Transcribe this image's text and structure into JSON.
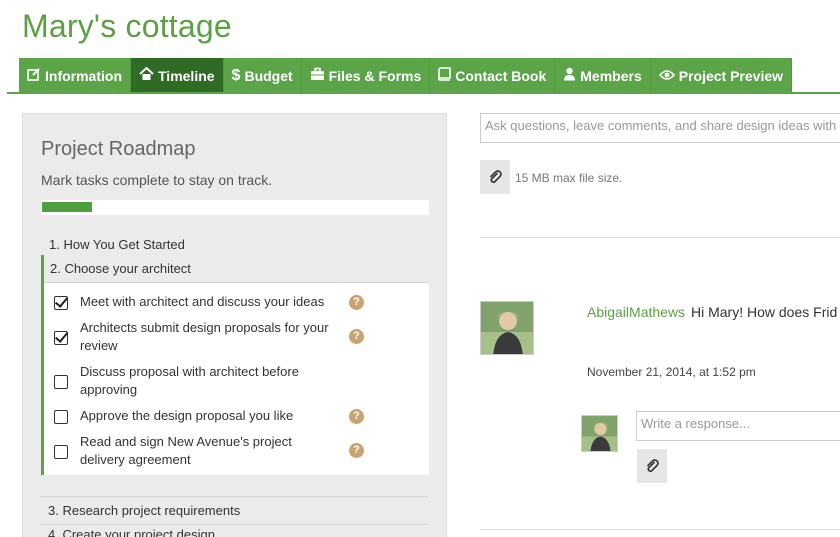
{
  "project": {
    "title": "Mary's cottage"
  },
  "tabs": [
    {
      "label": "Information",
      "icon": "edit-icon"
    },
    {
      "label": "Timeline",
      "icon": "home-icon",
      "active": true
    },
    {
      "label": "Budget",
      "icon": "dollar-icon"
    },
    {
      "label": "Files & Forms",
      "icon": "briefcase-icon"
    },
    {
      "label": "Contact Book",
      "icon": "book-icon"
    },
    {
      "label": "Members",
      "icon": "user-icon"
    },
    {
      "label": "Project Preview",
      "icon": "eye-icon"
    }
  ],
  "roadmap": {
    "title": "Project Roadmap",
    "subtitle": "Mark tasks complete to stay on track.",
    "progress": 0.13,
    "steps": [
      {
        "label": "1. How You Get Started"
      },
      {
        "label": "2. Choose your architect",
        "tasks": [
          {
            "text": "Meet with architect and discuss your ideas",
            "checked": true,
            "help": true
          },
          {
            "text": "Architects submit design proposals for your review",
            "checked": true,
            "help": true
          },
          {
            "text": "Discuss proposal with architect before approving",
            "checked": false,
            "help": false
          },
          {
            "text": "Approve the design proposal you like",
            "checked": false,
            "help": true
          },
          {
            "text": "Read and sign New Avenue's project delivery agreement",
            "checked": false,
            "help": true
          }
        ]
      },
      {
        "label": "3. Research project requirements"
      },
      {
        "label": "4. Create your project design"
      }
    ],
    "help_glyph": "?"
  },
  "feed": {
    "comment_placeholder": "Ask questions, leave comments, and share design ideas with",
    "max_file_note": "15 MB max file size.",
    "post": {
      "author": "AbigailMathews",
      "text": "Hi Mary! How does Frid",
      "timestamp": "November 21, 2014, at 1:52 pm"
    },
    "response_placeholder": "Write a response..."
  },
  "colors": {
    "accent": "#5ba548",
    "active_tab": "#2f6b24",
    "link": "#5ba044",
    "help": "#c9a46e"
  }
}
